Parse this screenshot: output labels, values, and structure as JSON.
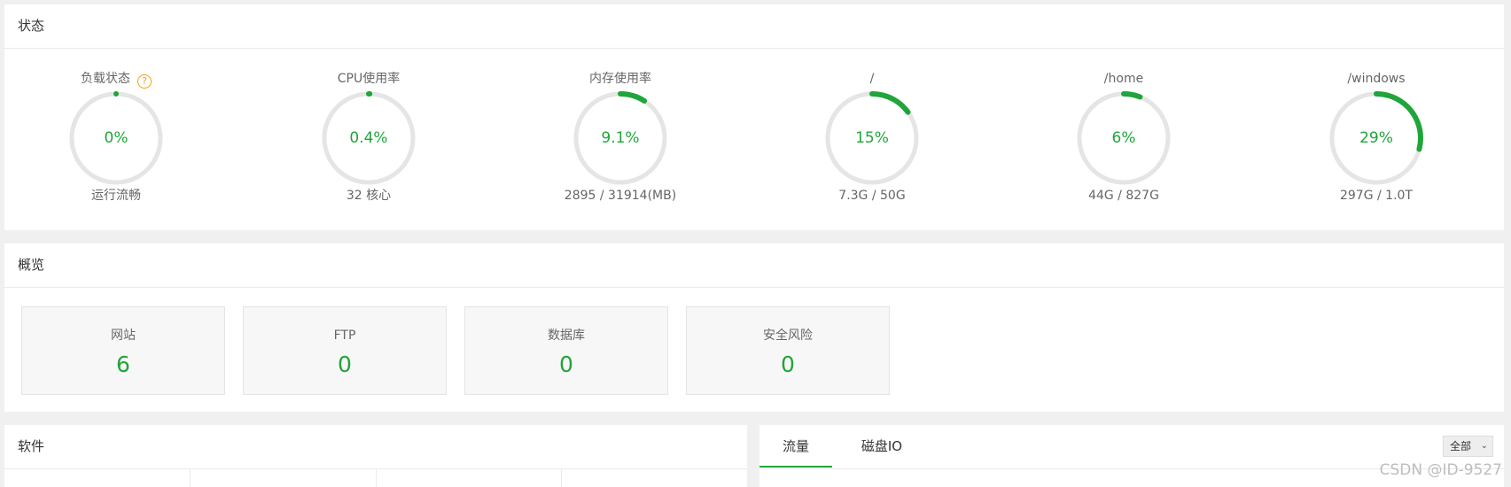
{
  "status": {
    "title": "状态",
    "gauges": [
      {
        "label": "负载状态",
        "value": "0%",
        "percent": 0,
        "sub": "运行流畅",
        "help": "?"
      },
      {
        "label": "CPU使用率",
        "value": "0.4%",
        "percent": 0.4,
        "sub": "32 核心"
      },
      {
        "label": "内存使用率",
        "value": "9.1%",
        "percent": 9.1,
        "sub": "2895 / 31914(MB)"
      },
      {
        "label": "/",
        "value": "15%",
        "percent": 15,
        "sub": "7.3G / 50G"
      },
      {
        "label": "/home",
        "value": "6%",
        "percent": 6,
        "sub": "44G / 827G"
      },
      {
        "label": "/windows",
        "value": "29%",
        "percent": 29,
        "sub": "297G / 1.0T"
      }
    ]
  },
  "overview": {
    "title": "概览",
    "cards": [
      {
        "label": "网站",
        "value": "6"
      },
      {
        "label": "FTP",
        "value": "0"
      },
      {
        "label": "数据库",
        "value": "0"
      },
      {
        "label": "安全风险",
        "value": "0"
      }
    ]
  },
  "software": {
    "title": "软件"
  },
  "traffic": {
    "tabs": [
      {
        "label": "流量"
      },
      {
        "label": "磁盘IO"
      }
    ],
    "select": {
      "value": "全部"
    }
  },
  "watermark": "CSDN @ID-9527",
  "colors": {
    "accent": "#20a53a",
    "track": "#e5e5e5",
    "help": "#f39c12"
  }
}
